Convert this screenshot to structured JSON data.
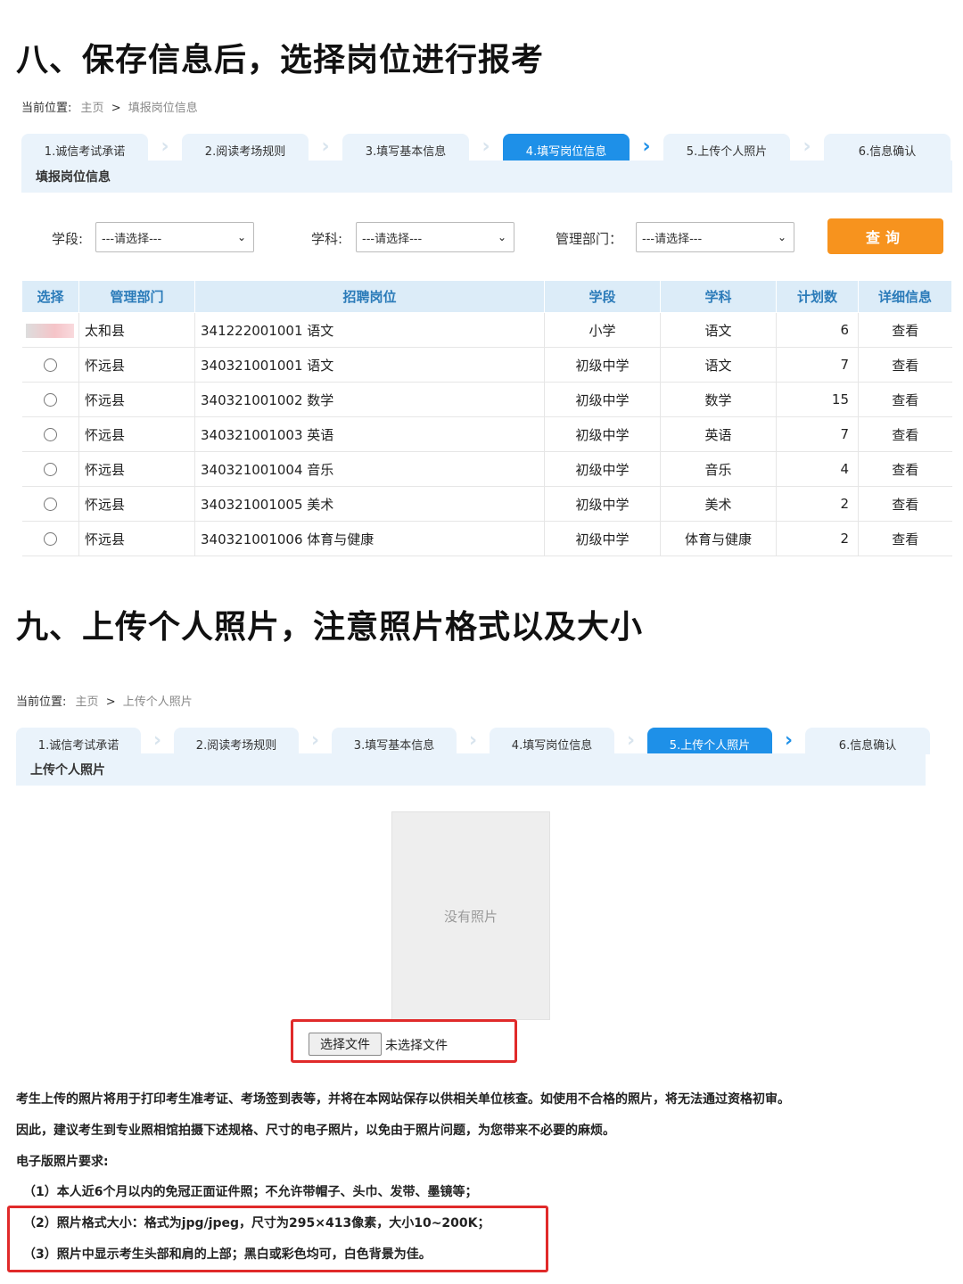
{
  "section8": {
    "title": "八、保存信息后，选择岗位进行报考",
    "breadcrumb": {
      "label": "当前位置:",
      "home": "主页",
      "sep": ">",
      "current": "填报岗位信息"
    },
    "steps": [
      "1.诚信考试承诺",
      "2.阅读考场规则",
      "3.填写基本信息",
      "4.填写岗位信息",
      "5.上传个人照片",
      "6.信息确认"
    ],
    "active_step": 3,
    "panel_title": "填报岗位信息",
    "filters": {
      "stage_label": "学段:",
      "stage_value": "---请选择---",
      "subject_label": "学科:",
      "subject_value": "---请选择---",
      "dept_label": "管理部门：",
      "dept_value": "---请选择---",
      "query_label": "查询"
    },
    "table": {
      "headers": [
        "选择",
        "管理部门",
        "招聘岗位",
        "学段",
        "学科",
        "计划数",
        "详细信息"
      ],
      "rows": [
        {
          "dept": "太和县",
          "position": "341222001001 语文",
          "stage": "小学",
          "subject": "语文",
          "plan": "6",
          "detail": "查看"
        },
        {
          "dept": "怀远县",
          "position": "340321001001 语文",
          "stage": "初级中学",
          "subject": "语文",
          "plan": "7",
          "detail": "查看"
        },
        {
          "dept": "怀远县",
          "position": "340321001002 数学",
          "stage": "初级中学",
          "subject": "数学",
          "plan": "15",
          "detail": "查看"
        },
        {
          "dept": "怀远县",
          "position": "340321001003 英语",
          "stage": "初级中学",
          "subject": "英语",
          "plan": "7",
          "detail": "查看"
        },
        {
          "dept": "怀远县",
          "position": "340321001004 音乐",
          "stage": "初级中学",
          "subject": "音乐",
          "plan": "4",
          "detail": "查看"
        },
        {
          "dept": "怀远县",
          "position": "340321001005 美术",
          "stage": "初级中学",
          "subject": "美术",
          "plan": "2",
          "detail": "查看"
        },
        {
          "dept": "怀远县",
          "position": "340321001006 体育与健康",
          "stage": "初级中学",
          "subject": "体育与健康",
          "plan": "2",
          "detail": "查看"
        }
      ]
    }
  },
  "section9": {
    "title": "九、上传个人照片，注意照片格式以及大小",
    "breadcrumb": {
      "label": "当前位置:",
      "home": "主页",
      "sep": ">",
      "current": "上传个人照片"
    },
    "steps": [
      "1.诚信考试承诺",
      "2.阅读考场规则",
      "3.填写基本信息",
      "4.填写岗位信息",
      "5.上传个人照片",
      "6.信息确认"
    ],
    "active_step": 4,
    "panel_title": "上传个人照片",
    "photo_placeholder": "没有照片",
    "file_button": "选择文件",
    "file_status": "未选择文件",
    "note_line1": "考生上传的照片将用于打印考生准考证、考场签到表等，并将在本网站保存以供相关单位核查。如使用不合格的照片，将无法通过资格初审。",
    "note_line2": "因此，建议考生到专业照相馆拍摄下述规格、尺寸的电子照片，以免由于照片问题，为您带来不必要的麻烦。",
    "req_title": "电子版照片要求:",
    "req1": "（1）本人近6个月以内的免冠正面证件照；不允许带帽子、头巾、发带、墨镜等；",
    "req2": "（2）照片格式大小：格式为jpg/jpeg，尺寸为295×413像素，大小10~200K；",
    "req3": "（3）照片中显示考生头部和肩的上部；黑白或彩色均可，白色背景为佳。"
  }
}
